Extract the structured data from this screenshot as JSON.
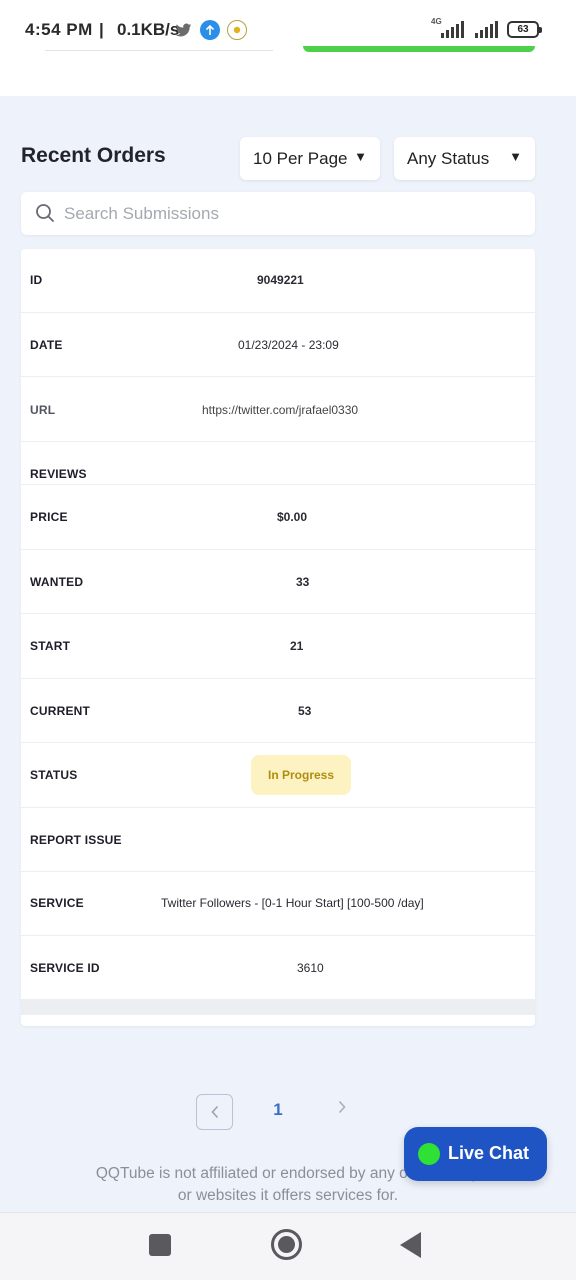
{
  "status_bar": {
    "time": "4:54  PM",
    "separator": "|",
    "speed": "0.1KB/s",
    "network_type": "4G",
    "battery": "63",
    "icons": [
      "twitter-icon",
      "upload-icon",
      "coin-icon",
      "signal-icon",
      "battery-icon"
    ]
  },
  "header": {
    "title": "Recent Orders",
    "per_page": "10 Per Page",
    "status_filter": "Any Status",
    "caret": "▼"
  },
  "search": {
    "placeholder": "Search Submissions"
  },
  "order": {
    "rows": [
      {
        "label": "ID",
        "value": "9049221"
      },
      {
        "label": "DATE",
        "value": "01/23/2024 - 23:09"
      },
      {
        "label": "URL",
        "value": "https://twitter.com/jrafael0330"
      },
      {
        "label": "REVIEWS",
        "value": ""
      },
      {
        "label": "PRICE",
        "value": "$0.00"
      },
      {
        "label": "WANTED",
        "value": "33"
      },
      {
        "label": "START",
        "value": "21"
      },
      {
        "label": "CURRENT",
        "value": "53"
      },
      {
        "label": "STATUS",
        "value": "In Progress"
      },
      {
        "label": "REPORT ISSUE",
        "value": ""
      },
      {
        "label": "SERVICE",
        "value": "Twitter Followers - [0-1 Hour Start] [100-500 /day]"
      },
      {
        "label": "SERVICE ID",
        "value": "3610"
      }
    ]
  },
  "pagination": {
    "prev": "‹",
    "current_page": "1",
    "next": "›"
  },
  "footer": {
    "line1": "QQTube is not affiliated or endorsed by any of the comp",
    "line2": "or websites it offers services for."
  },
  "live_chat": {
    "label": "Live Chat",
    "indicator_color": "#2fe035",
    "bg_color": "#1f54c4"
  },
  "colors": {
    "accent": "#3b6fc9",
    "status_badge_bg": "#fdf3c2",
    "status_badge_text": "#b08d10",
    "page_bg": "#eef2fb"
  }
}
